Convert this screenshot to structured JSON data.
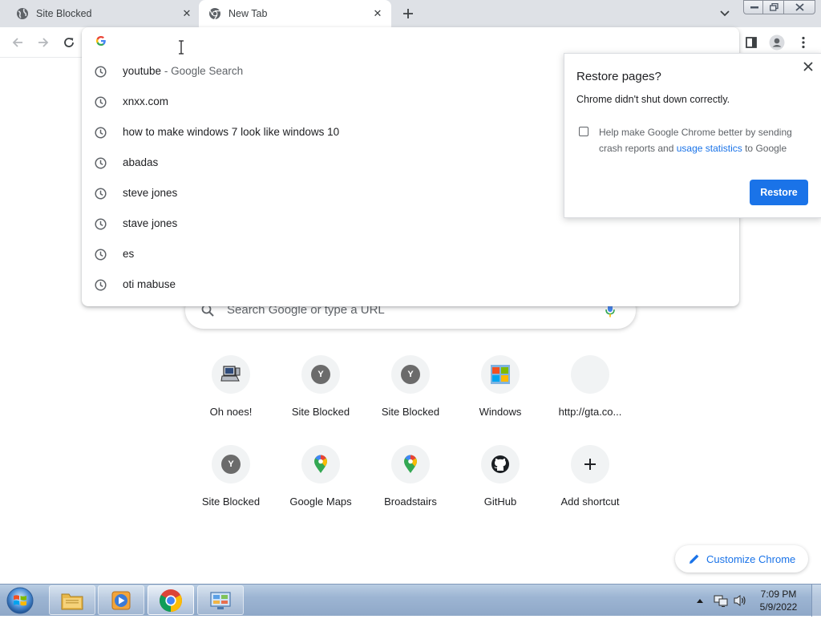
{
  "browser": {
    "tabs": [
      {
        "title": "Site Blocked",
        "active": false
      },
      {
        "title": "New Tab",
        "active": true
      }
    ]
  },
  "omnibox": {
    "value": "",
    "suggestions": [
      {
        "text": "youtube",
        "suffix": "Google Search",
        "separator": "-"
      },
      {
        "text": "xnxx.com"
      },
      {
        "text": "how to make windows 7 look like windows 10"
      },
      {
        "text": "abadas"
      },
      {
        "text": "steve jones"
      },
      {
        "text": "stave jones"
      },
      {
        "text": "es"
      },
      {
        "text": "oti mabuse"
      }
    ]
  },
  "ntp": {
    "search_placeholder": "Search Google or type a URL",
    "shortcuts": [
      {
        "label": "Oh noes!",
        "icon": "computer-icon"
      },
      {
        "label": "Site Blocked",
        "icon": "y-badge-icon",
        "badge": "Y"
      },
      {
        "label": "Site Blocked",
        "icon": "y-badge-icon",
        "badge": "Y"
      },
      {
        "label": "Windows",
        "icon": "windows-thumb-icon"
      },
      {
        "label": "http://gta.co...",
        "icon": "blank-icon"
      },
      {
        "label": "Site Blocked",
        "icon": "y-badge-icon",
        "badge": "Y"
      },
      {
        "label": "Google Maps",
        "icon": "maps-pin-icon"
      },
      {
        "label": "Broadstairs",
        "icon": "maps-pin-icon"
      },
      {
        "label": "GitHub",
        "icon": "github-icon"
      },
      {
        "label": "Add shortcut",
        "icon": "plus-icon"
      }
    ],
    "customize_label": "Customize Chrome"
  },
  "restore_bubble": {
    "title": "Restore pages?",
    "message": "Chrome didn't shut down correctly.",
    "checkbox_text_before": "Help make Google Chrome better by sending crash reports and ",
    "checkbox_link": "usage statistics",
    "checkbox_text_after": " to Google",
    "button_label": "Restore"
  },
  "taskbar": {
    "time": "7:09 PM",
    "date": "5/9/2022"
  },
  "colors": {
    "accent": "#1a73e8",
    "tabstrip": "#dee1e6",
    "taskbar": "#9db5d3"
  }
}
